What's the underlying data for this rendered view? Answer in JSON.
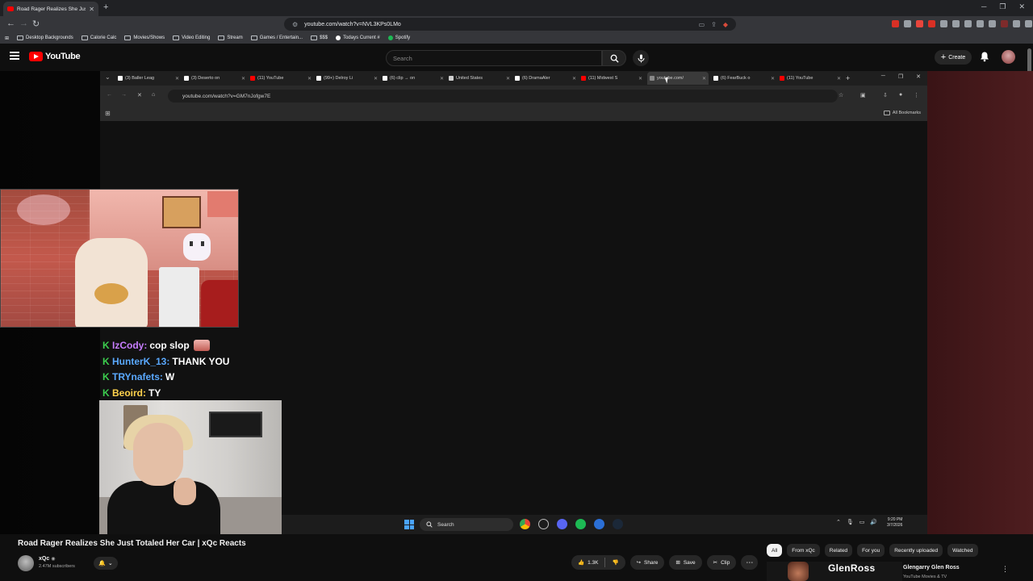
{
  "browser": {
    "active_tab_title": "Road Rager Realizes She Just Totaled Her Car | xQc Reacts - YouTube",
    "url": "youtube.com/watch?v=NVL3KPs0LMo",
    "bookmarks": [
      "Desktop Backgrounds",
      "Calorie Calc",
      "Movies/Shows",
      "Video Editing",
      "Stream",
      "Games / Entertain...",
      "$$$",
      "Todays Current #",
      "Spotify"
    ]
  },
  "youtube": {
    "logo_text": "YouTube",
    "search_placeholder": "Search",
    "create_label": "Create"
  },
  "inner_browser": {
    "tabs": [
      {
        "label": "(3) Baller Leag",
        "color": "#ffffff"
      },
      {
        "label": "(3) Deserto on",
        "color": "#ffffff"
      },
      {
        "label": "(11) YouTube",
        "color": "#ff0000"
      },
      {
        "label": "(99+) Delroy Li",
        "color": "#ffffff"
      },
      {
        "label": "(6) clip → on",
        "color": "#ffffff"
      },
      {
        "label": "United States",
        "color": "#cfcfcf"
      },
      {
        "label": "(6) DramaAler",
        "color": "#ffffff"
      },
      {
        "label": "(11) Midwest S",
        "color": "#ff0000"
      },
      {
        "label": "youtube.com/",
        "color": "#888888"
      },
      {
        "label": "(6) FearBuck o",
        "color": "#ffffff"
      },
      {
        "label": "(11) YouTube",
        "color": "#ff0000"
      }
    ],
    "url": "youtube.com/watch?v=GM7nJofgw7E",
    "all_bookmarks_label": "All Bookmarks",
    "taskbar_search": "Search",
    "clock_time": "9:20 PM",
    "clock_date": "3/7/2026"
  },
  "chat": [
    {
      "user": "IzCody:",
      "message": "cop slop",
      "user_color": "#c77dff",
      "emote": true
    },
    {
      "user": "HunterK_13:",
      "message": "THANK YOU",
      "user_color": "#5aa9ff",
      "emote": false
    },
    {
      "user": "TRYnafets:",
      "message": "W",
      "user_color": "#5aa9ff",
      "emote": false
    },
    {
      "user": "Beoird:",
      "message": "TY",
      "user_color": "#ffd34d",
      "emote": false
    }
  ],
  "video": {
    "title": "Road Rager Realizes She Just Totaled Her Car | xQc Reacts",
    "channel": "xQc",
    "subscribers": "2.47M subscribers",
    "likes": "1.3K",
    "share_label": "Share",
    "save_label": "Save",
    "clip_label": "Clip"
  },
  "recommendations": {
    "chips": [
      "All",
      "From xQc",
      "Related",
      "For you",
      "Recently uploaded",
      "Watched"
    ],
    "selected_chip": "All",
    "first_thumb_text": "GlenRoss",
    "first_title": "Glengarry Glen Ross",
    "first_meta": "YouTube Movies & TV"
  },
  "colors": {
    "youtube_red": "#ff0000",
    "chat_badge_green": "#3ccf4e"
  }
}
